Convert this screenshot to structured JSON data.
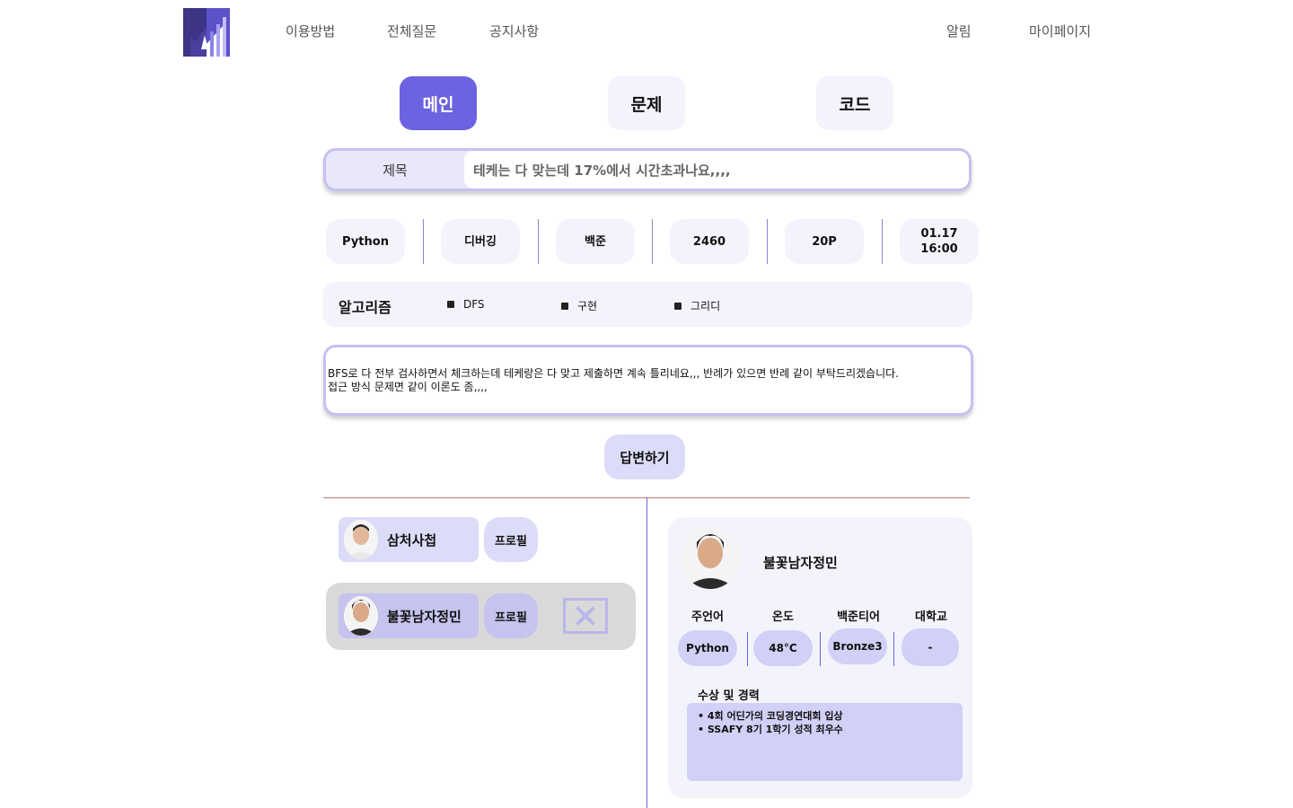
{
  "header": {
    "nav_left": [
      "이용방법",
      "전체질문",
      "공지사항"
    ],
    "nav_right": [
      "알림",
      "마이페이지"
    ]
  },
  "tabs": [
    {
      "label": "메인",
      "active": true
    },
    {
      "label": "문제",
      "active": false
    },
    {
      "label": "코드",
      "active": false
    }
  ],
  "question": {
    "title_label": "제목",
    "title": "테케는 다 맞는데 17%에서 시간초과나요,,,,",
    "meta": {
      "language": "Python",
      "category": "디버깅",
      "site": "백준",
      "problem_number": "2460",
      "points": "20P",
      "date": "01.17",
      "time": "16:00"
    },
    "algorithm_label": "알고리즘",
    "algorithms": [
      "DFS",
      "구현",
      "그리디"
    ],
    "content_line1": "BFS로 다 전부 검사하면서 체크하는데 테케랑은 다 맞고 제출하면 계속 틀리네요,,, 반례가 있으면 반례 같이 부탁드리겠습니다.",
    "content_line2": "접근 방식 문제면 같이 이론도 좀,,,,"
  },
  "answer_button": "답변하기",
  "answerers": [
    {
      "name": "삼처사첩",
      "profile_label": "프로필",
      "selected": false
    },
    {
      "name": "불꽃남자정민",
      "profile_label": "프로필",
      "selected": true
    }
  ],
  "profile_card": {
    "name": "불꽃남자정민",
    "stats": [
      {
        "label": "주언어",
        "value": "Python"
      },
      {
        "label": "온도",
        "value": "48°C"
      },
      {
        "label": "백준티어",
        "value": "Bronze3"
      },
      {
        "label": "대학교",
        "value": "-"
      }
    ],
    "career_title": "수상 및 경력",
    "careers": [
      "4회 어딘가의 코딩경연대회 입상",
      "SSAFY 8기 1학기 성적 최우수"
    ]
  },
  "colors": {
    "accent": "#6c63e0",
    "light": "#f3f3fc",
    "chip": "#dcdbf8"
  },
  "icons": [
    "logo-icon",
    "close-icon",
    "avatar-icon"
  ]
}
